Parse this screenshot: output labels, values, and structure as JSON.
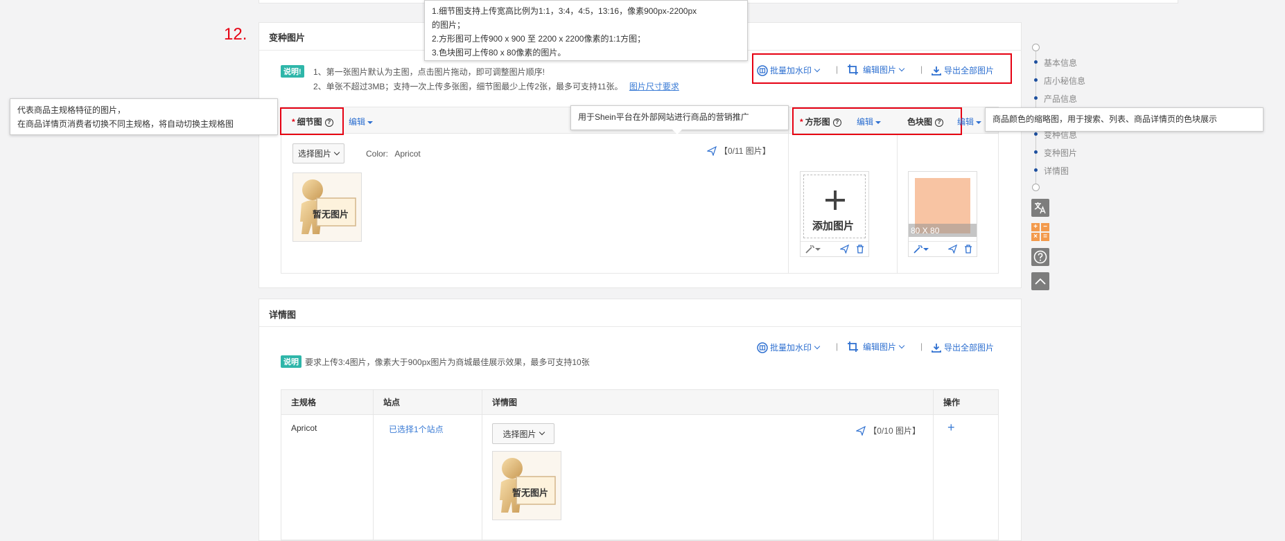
{
  "step_number": "12.",
  "variant_section": {
    "title": "变种图片",
    "note_badge": "说明!",
    "note_line1": "1、第一张图片默认为主图，点击图片拖动，即可调整图片顺序!",
    "note_line2": "2、单张不超过3MB；支持一次上传多张图，细节图最少上传2张，最多可支持11张。",
    "size_link": "图片尺寸要求",
    "toolbar": {
      "watermark": "批量加水印",
      "edit": "编辑图片",
      "export": "导出全部图片",
      "separator": "|"
    },
    "detail_col": {
      "label": "细节图",
      "required": "*",
      "edit": "编辑"
    },
    "square_col": {
      "label": "方形图",
      "required": "*",
      "edit": "编辑"
    },
    "swatch_col": {
      "label": "色块图",
      "edit": "编辑"
    },
    "select_button": "选择图片",
    "color_label": "Color:",
    "color_value": "Apricot",
    "detail_count": "【0/11 图片】",
    "no_image_text": "暂无图片",
    "add_image_text": "添加图片",
    "swatch_size": "80 X 80",
    "swatch_color": "#f8c4a3"
  },
  "tooltips": {
    "size_rules_1": "1.细节图支持上传宽高比例为1:1，3:4，4:5，13:16，像素900px-2200px",
    "size_rules_1b": "的图片；",
    "size_rules_2": "2.方形图可上传900 x 900 至 2200 x 2200像素的1:1方图；",
    "size_rules_3": "3.色块图可上传80 x 80像素的图片。",
    "detail_tip_1": "代表商品主规格特征的图片，",
    "detail_tip_2": "在商品详情页消费者切换不同主规格，将自动切换主规格图",
    "square_tip": "用于Shein平台在外部网站进行商品的营销推广",
    "swatch_tip": "商品颜色的缩略图，用于搜索、列表、商品详情页的色块展示"
  },
  "detail_section": {
    "title": "详情图",
    "note_badge": "说明",
    "note_text": "要求上传3:4图片，像素大于900px图片为商城最佳展示效果，最多可支持10张",
    "toolbar": {
      "watermark": "批量加水印",
      "edit": "编辑图片",
      "export": "导出全部图片",
      "separator": "|"
    },
    "table": {
      "headers": [
        "主规格",
        "站点",
        "详情图",
        "操作"
      ],
      "row": {
        "spec": "Apricot",
        "site": "已选择1个站点",
        "select_button": "选择图片",
        "count": "【0/10 图片】",
        "add": "+"
      }
    },
    "no_image_text": "暂无图片"
  },
  "side_nav": {
    "items": [
      "基本信息",
      "店小秘信息",
      "产品信息",
      "变种信息",
      "变种图片",
      "详情图"
    ]
  },
  "colors": {
    "accent": "#2d6fd0",
    "highlight_red": "#e60012",
    "badge_teal": "#2eb6a9"
  }
}
